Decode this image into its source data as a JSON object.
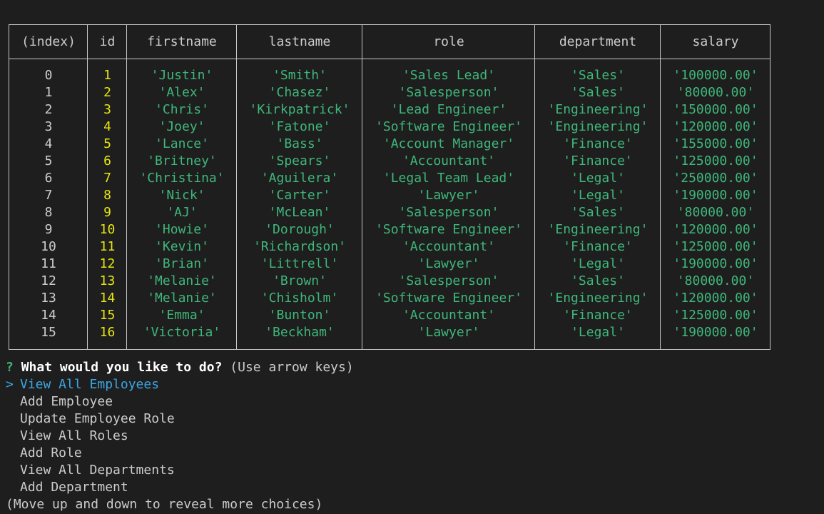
{
  "table": {
    "columns": [
      "(index)",
      "id",
      "firstname",
      "lastname",
      "role",
      "department",
      "salary"
    ],
    "rows": [
      [
        "0",
        "1",
        "'Justin'",
        "'Smith'",
        "'Sales Lead'",
        "'Sales'",
        "'100000.00'"
      ],
      [
        "1",
        "2",
        "'Alex'",
        "'Chasez'",
        "'Salesperson'",
        "'Sales'",
        "'80000.00'"
      ],
      [
        "2",
        "3",
        "'Chris'",
        "'Kirkpatrick'",
        "'Lead Engineer'",
        "'Engineering'",
        "'150000.00'"
      ],
      [
        "3",
        "4",
        "'Joey'",
        "'Fatone'",
        "'Software Engineer'",
        "'Engineering'",
        "'120000.00'"
      ],
      [
        "4",
        "5",
        "'Lance'",
        "'Bass'",
        "'Account Manager'",
        "'Finance'",
        "'155000.00'"
      ],
      [
        "5",
        "6",
        "'Britney'",
        "'Spears'",
        "'Accountant'",
        "'Finance'",
        "'125000.00'"
      ],
      [
        "6",
        "7",
        "'Christina'",
        "'Aguilera'",
        "'Legal Team Lead'",
        "'Legal'",
        "'250000.00'"
      ],
      [
        "7",
        "8",
        "'Nick'",
        "'Carter'",
        "'Lawyer'",
        "'Legal'",
        "'190000.00'"
      ],
      [
        "8",
        "9",
        "'AJ'",
        "'McLean'",
        "'Salesperson'",
        "'Sales'",
        "'80000.00'"
      ],
      [
        "9",
        "10",
        "'Howie'",
        "'Dorough'",
        "'Software Engineer'",
        "'Engineering'",
        "'120000.00'"
      ],
      [
        "10",
        "11",
        "'Kevin'",
        "'Richardson'",
        "'Accountant'",
        "'Finance'",
        "'125000.00'"
      ],
      [
        "11",
        "12",
        "'Brian'",
        "'Littrell'",
        "'Lawyer'",
        "'Legal'",
        "'190000.00'"
      ],
      [
        "12",
        "13",
        "'Melanie'",
        "'Brown'",
        "'Salesperson'",
        "'Sales'",
        "'80000.00'"
      ],
      [
        "13",
        "14",
        "'Melanie'",
        "'Chisholm'",
        "'Software Engineer'",
        "'Engineering'",
        "'120000.00'"
      ],
      [
        "14",
        "15",
        "'Emma'",
        "'Bunton'",
        "'Accountant'",
        "'Finance'",
        "'125000.00'"
      ],
      [
        "15",
        "16",
        "'Victoria'",
        "'Beckham'",
        "'Lawyer'",
        "'Legal'",
        "'190000.00'"
      ]
    ]
  },
  "prompt": {
    "mark": "?",
    "question": "What would you like to do?",
    "hint": "(Use arrow keys)"
  },
  "menu": {
    "pointer": ">",
    "selected_index": 0,
    "items": [
      "View All Employees",
      "Add Employee",
      "Update Employee Role",
      "View All Roles",
      "Add Role",
      "View All Departments",
      "Add Department"
    ]
  },
  "footer_hint": "(Move up and down to reveal more choices)",
  "colors": {
    "background": "#1e1e1e",
    "string_value": "#3fb77a",
    "number_value": "#e5e510",
    "selected_item": "#3ba7e3",
    "border": "#c8c8c8"
  }
}
